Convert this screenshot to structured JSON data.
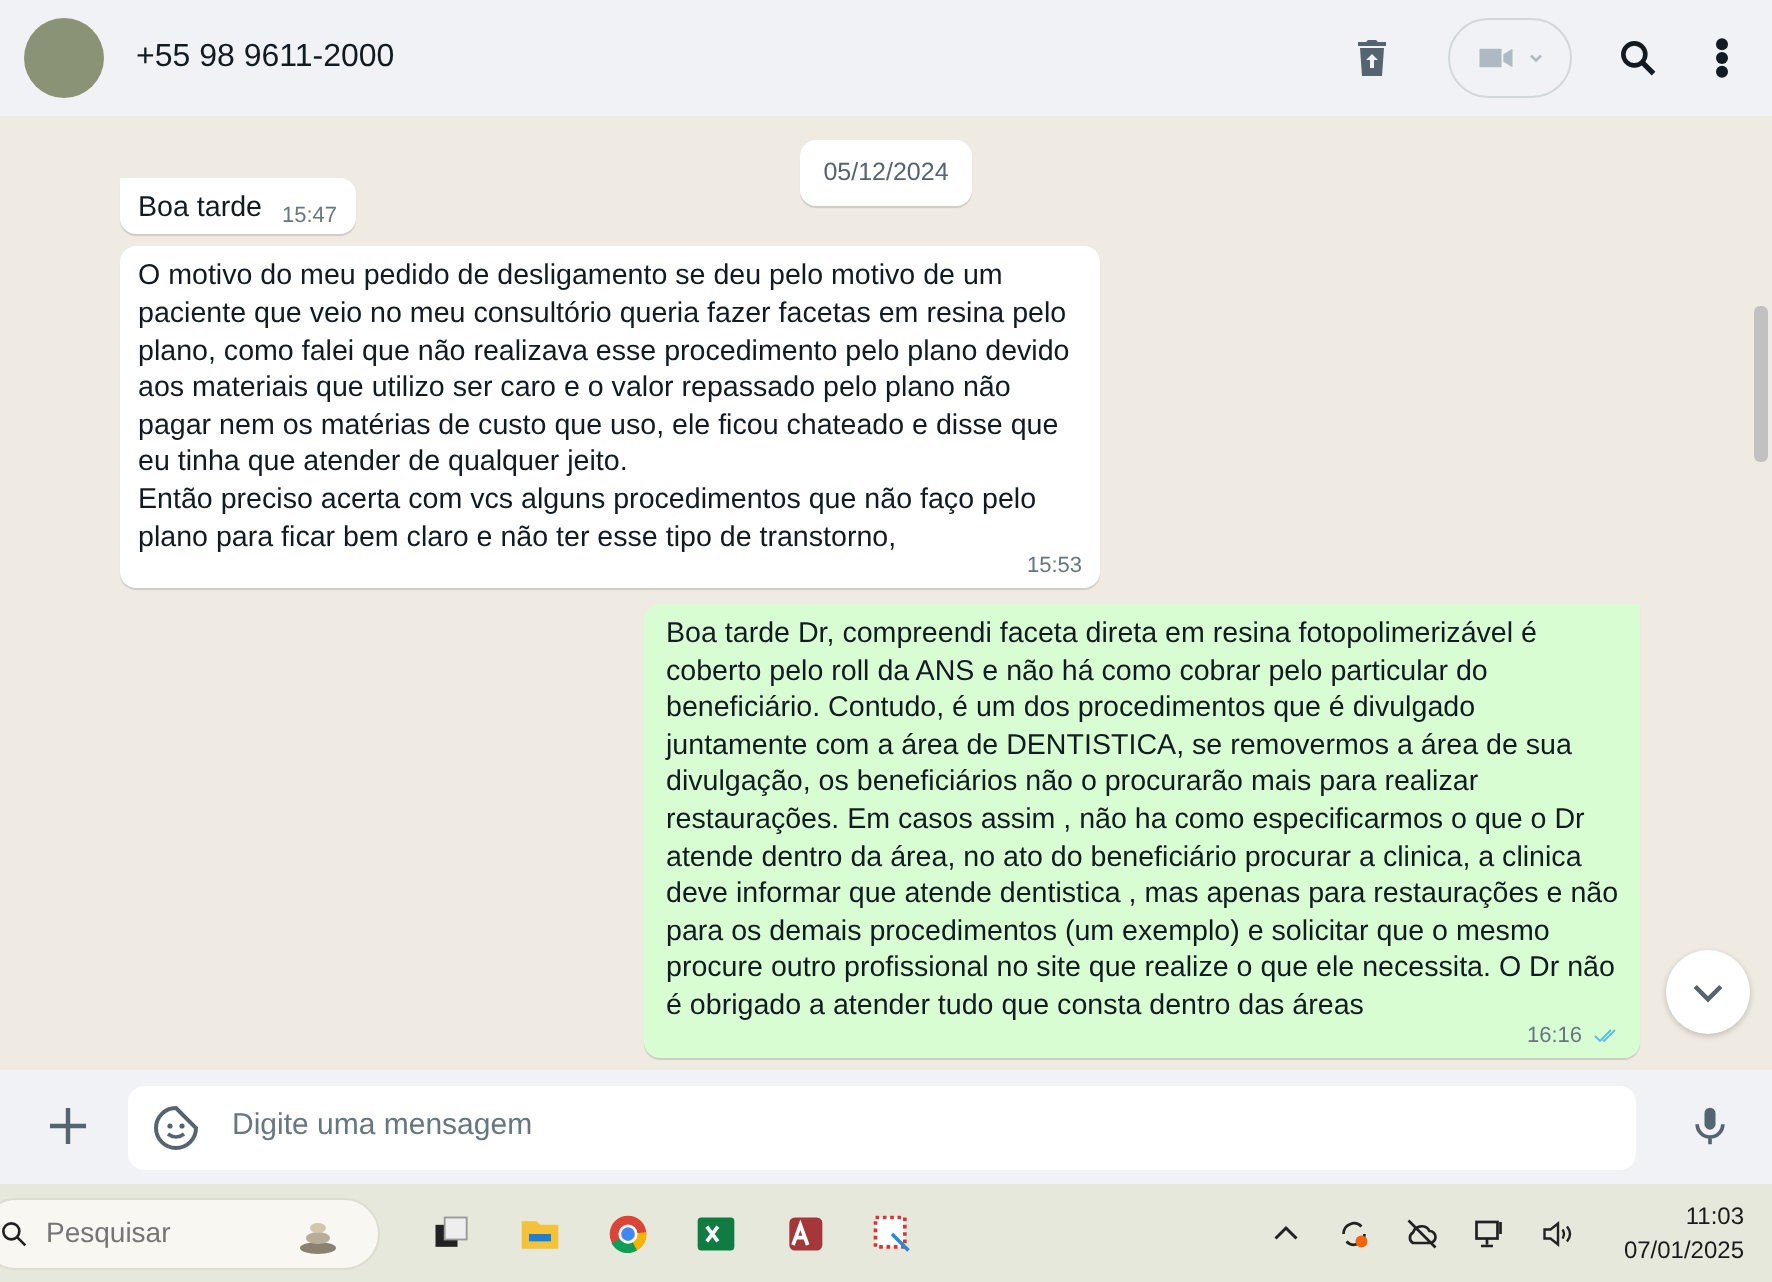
{
  "header": {
    "contact": "+55 98 9611-2000"
  },
  "date_chip": "05/12/2024",
  "messages": [
    {
      "kind": "incoming",
      "text": "Boa tarde",
      "time": "15:47",
      "tail": true
    },
    {
      "kind": "incoming",
      "text": "O motivo do meu pedido de desligamento se deu pelo motivo de um paciente que veio no meu consultório queria fazer facetas em resina pelo plano, como falei que não realizava esse procedimento pelo plano devido aos materiais que utilizo ser caro e o valor repassado pelo plano não pagar nem os matérias de custo que uso, ele ficou chateado e disse que eu tinha que atender de qualquer jeito.\nEntão preciso acerta com vcs alguns procedimentos que não faço pelo plano para ficar bem claro e não ter esse tipo de transtorno,",
      "time": "15:53",
      "tail": false
    },
    {
      "kind": "outgoing",
      "text": "Boa tarde Dr, compreendi faceta direta em resina fotopolimerizável é coberto pelo roll da ANS e não há como cobrar pelo particular do beneficiário. Contudo, é um dos procedimentos que é divulgado juntamente com a área de DENTISTICA, se removermos a área de sua divulgação, os beneficiários não o procurarão mais para realizar restaurações. Em casos assim , não ha como especificarmos o que o Dr atende dentro da área, no ato do beneficiário procurar a clinica, a clinica deve informar que atende dentistica , mas apenas para restaurações e não para os demais procedimentos (um exemplo) e solicitar que o mesmo procure outro profissional no site que realize o que ele necessita. O Dr não é obrigado a atender tudo que consta dentro das áreas",
      "time": "16:16",
      "tail": true,
      "read": true
    }
  ],
  "composer": {
    "placeholder": "Digite uma mensagem"
  },
  "taskbar": {
    "search_placeholder": "Pesquisar",
    "time": "11:03",
    "date": "07/01/2025"
  }
}
